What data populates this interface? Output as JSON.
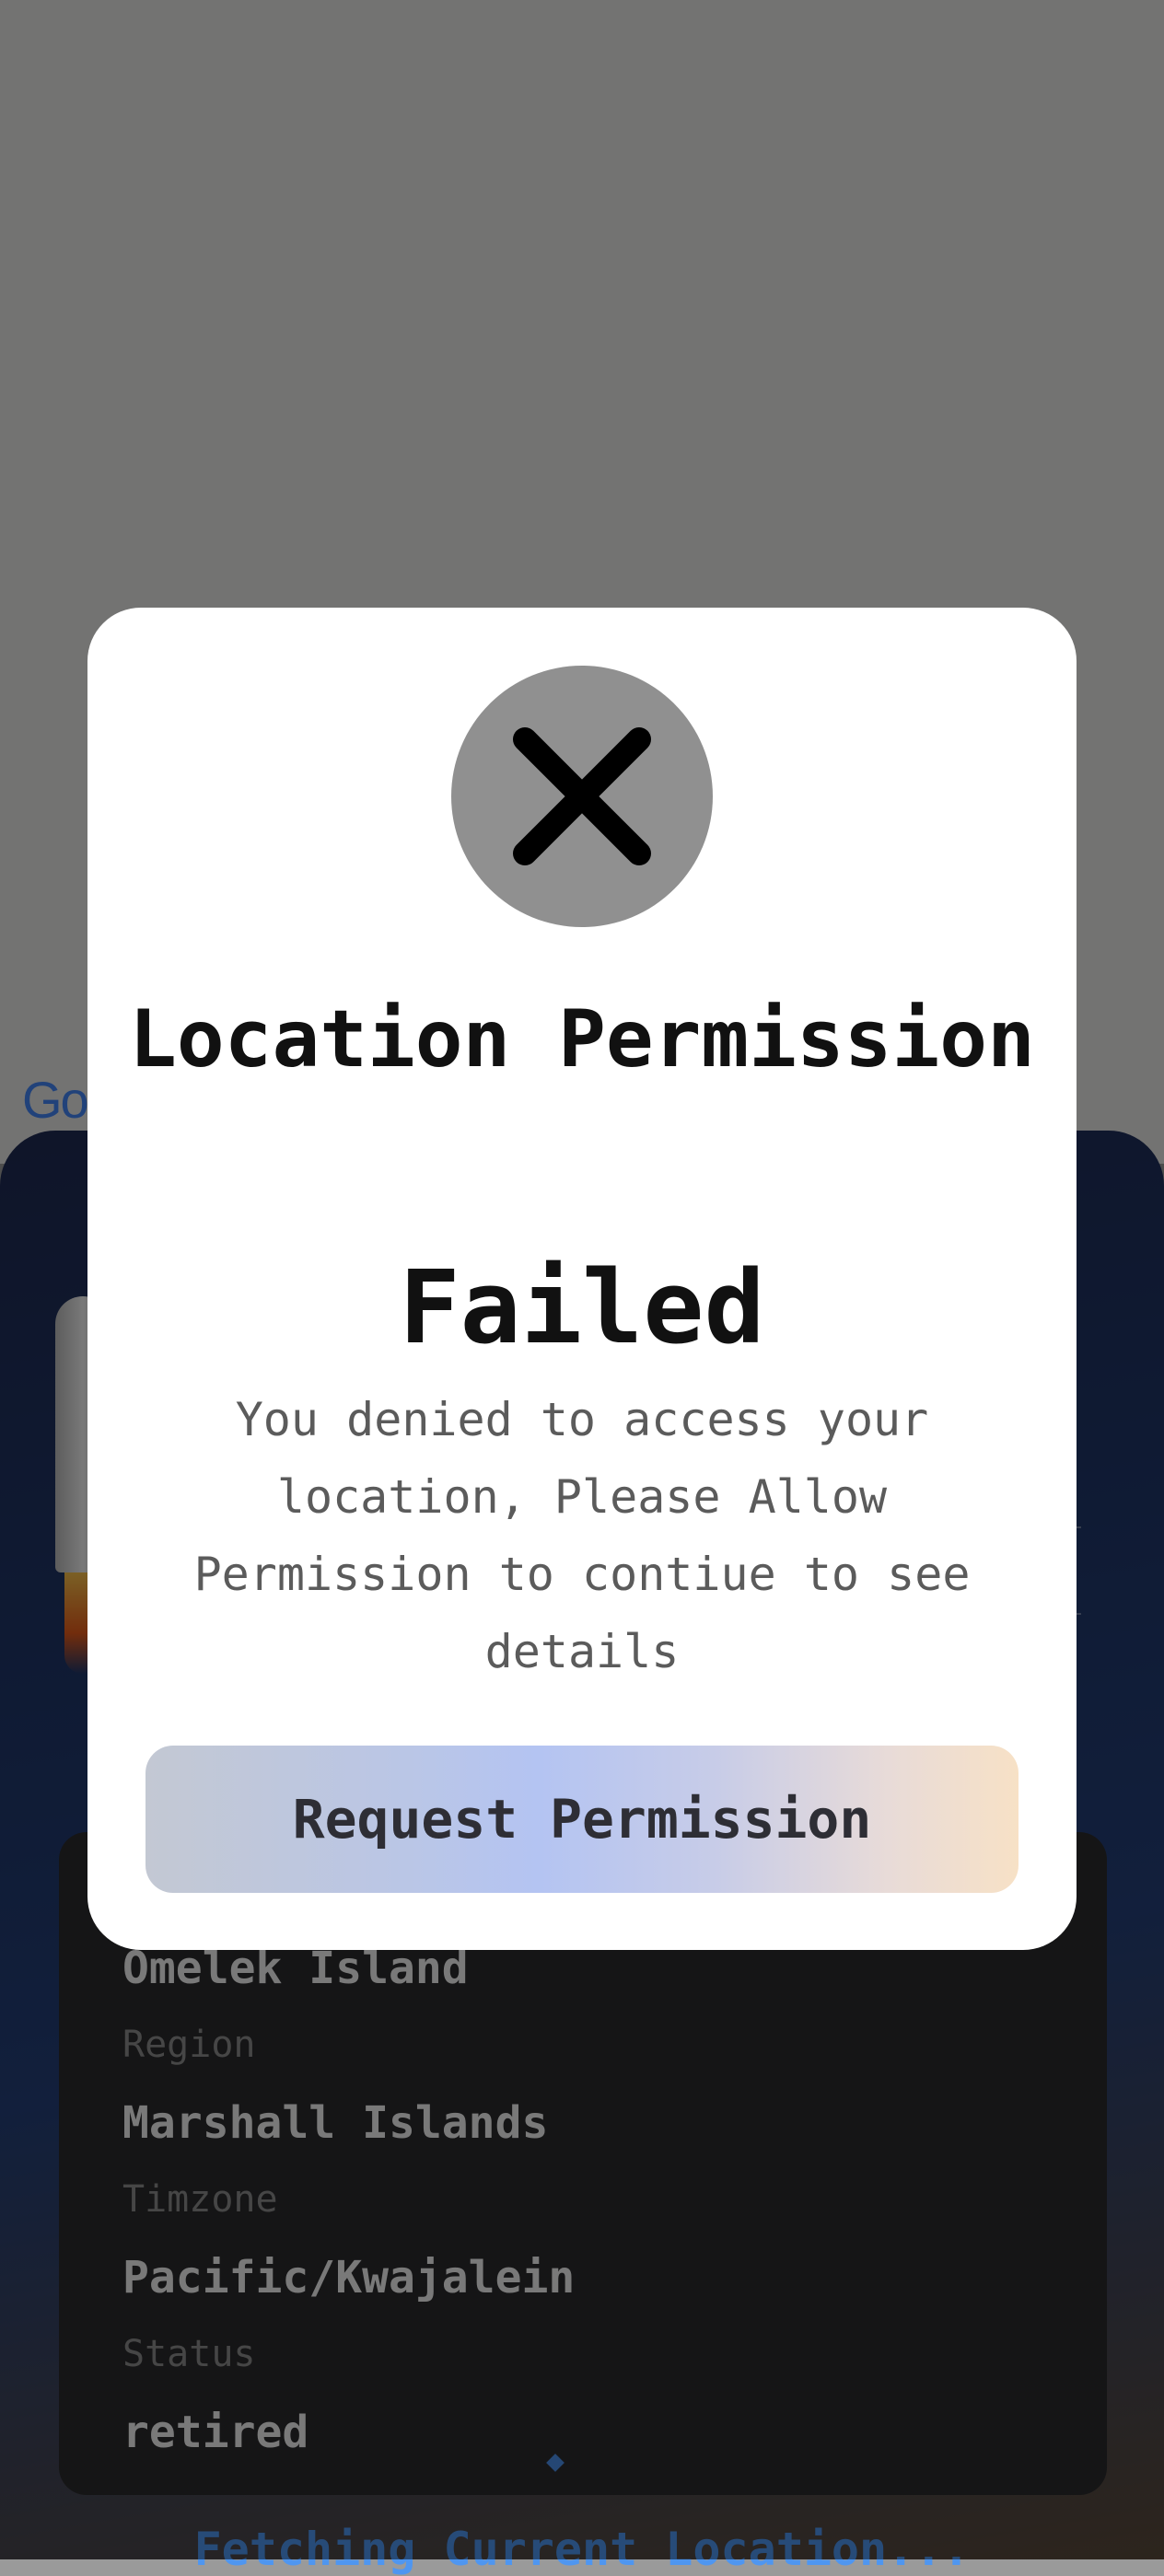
{
  "map": {
    "logo_text": "Go"
  },
  "details": {
    "island_value": "Omelek Island",
    "region_label": "Region",
    "region_value": "Marshall Islands",
    "timezone_label": "Timzone",
    "timezone_value": "Pacific/Kwajalein",
    "status_label": "Status",
    "status_value": "retired"
  },
  "fetching_text": "Fetching Current Location...",
  "dialog": {
    "icon": "close-icon",
    "title": "Location Permission",
    "status": "Failed",
    "message": "You denied to access your location, Please Allow Permission to contiue to see details",
    "button_label": "Request Permission"
  },
  "colors": {
    "scrim": "rgba(0,0,0,0.5)",
    "dialog_bg": "#ffffff",
    "icon_circle": "#909090",
    "button_gradient_start": "#c3c8d3",
    "button_gradient_mid": "#b4c4f2",
    "button_gradient_end": "#f7e1c6",
    "link_blue": "#4f96f0"
  }
}
